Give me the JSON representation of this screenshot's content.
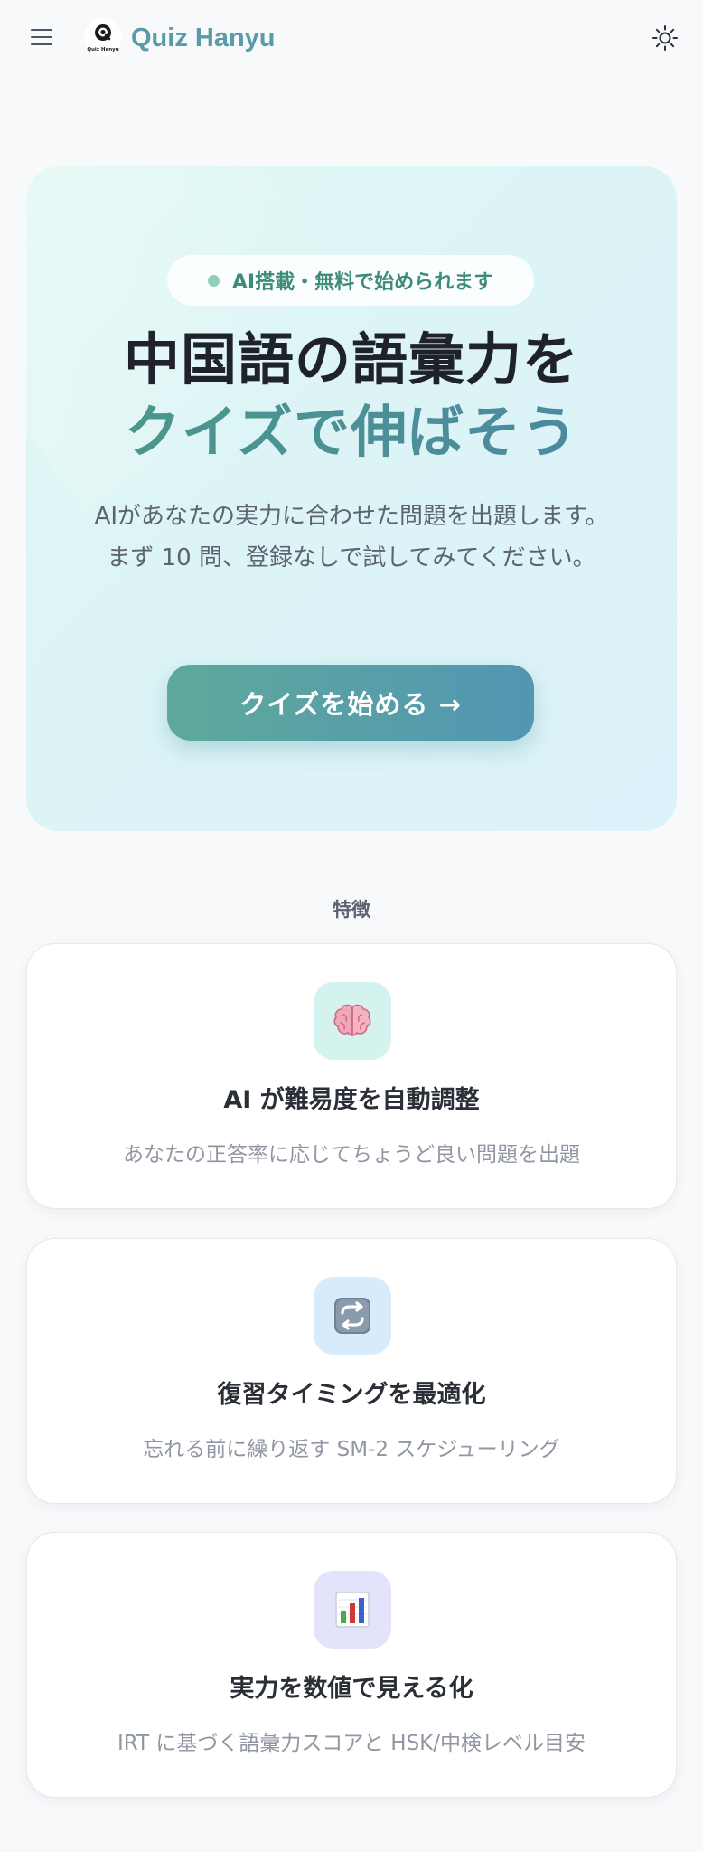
{
  "header": {
    "brand": "Quiz Hanyu",
    "logo_text": "Quiz Hanyu",
    "menu_icon": "hamburger-menu-icon",
    "theme_icon": "sun-icon"
  },
  "hero": {
    "badge": "AI搭載・無料で始められます",
    "title_line1": "中国語の語彙力を",
    "title_line2": "クイズで伸ばそう",
    "description_line1": "AIがあなたの実力に合わせた問題を出題します。",
    "description_line2": "まず 10 問、登録なしで試してみてください。",
    "cta_label": "クイズを始める →"
  },
  "features": {
    "label": "特徴",
    "items": [
      {
        "icon": "brain-icon",
        "title": "AI が難易度を自動調整",
        "description": "あなたの正答率に応じてちょうど良い問題を出題"
      },
      {
        "icon": "repeat-icon",
        "title": "復習タイミングを最適化",
        "description": "忘れる前に繰り返す SM-2 スケジューリング"
      },
      {
        "icon": "bar-chart-icon",
        "title": "実力を数値で見える化",
        "description": "IRT に基づく語彙力スコアと HSK/中検レベル目安"
      }
    ]
  },
  "colors": {
    "brand": "#5b9aa8",
    "hero_bg": "#dcf4f6",
    "cta_start": "#5ea99b",
    "cta_end": "#5296b3",
    "badge_text": "#3f8b7b"
  }
}
